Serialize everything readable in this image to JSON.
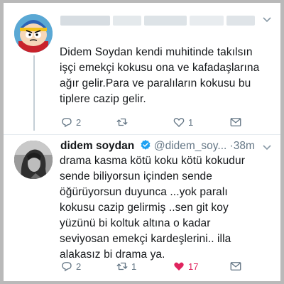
{
  "tweets": [
    {
      "text": "Didem Soydan kendi muhitinde takılsın\nişçi emekçi kokusu ona ve kafadaşlarına\nağır gelir.Para ve paralıların kokusu bu\ntiplere cazip gelir.",
      "reply_count": "2",
      "retweet_count": "",
      "like_count": "1",
      "liked": false
    },
    {
      "display_name": "didem soydan",
      "handle": "@didem_soy...",
      "time": "38m",
      "text": "drama kasma kötü koku kötü kokudur\nsende biliyorsun içinden sende\nöğürüyorsun duyunca ...yok paralı\nkokusu cazip gelirmiş ..sen git koy\nyüzünü bi koltuk altına o kadar\nseviyosan emekçi kardeşlerini.. illa\nalakasız bi drama ya.",
      "reply_count": "2",
      "retweet_count": "1",
      "like_count": "17",
      "liked": true
    }
  ],
  "colors": {
    "text": "#14171a",
    "secondary": "#657786",
    "like": "#e0245e",
    "verified": "#1da1f2"
  },
  "icons": [
    "reply-icon",
    "retweet-icon",
    "like-icon",
    "dm-icon",
    "verified-icon",
    "caret-down-icon"
  ]
}
